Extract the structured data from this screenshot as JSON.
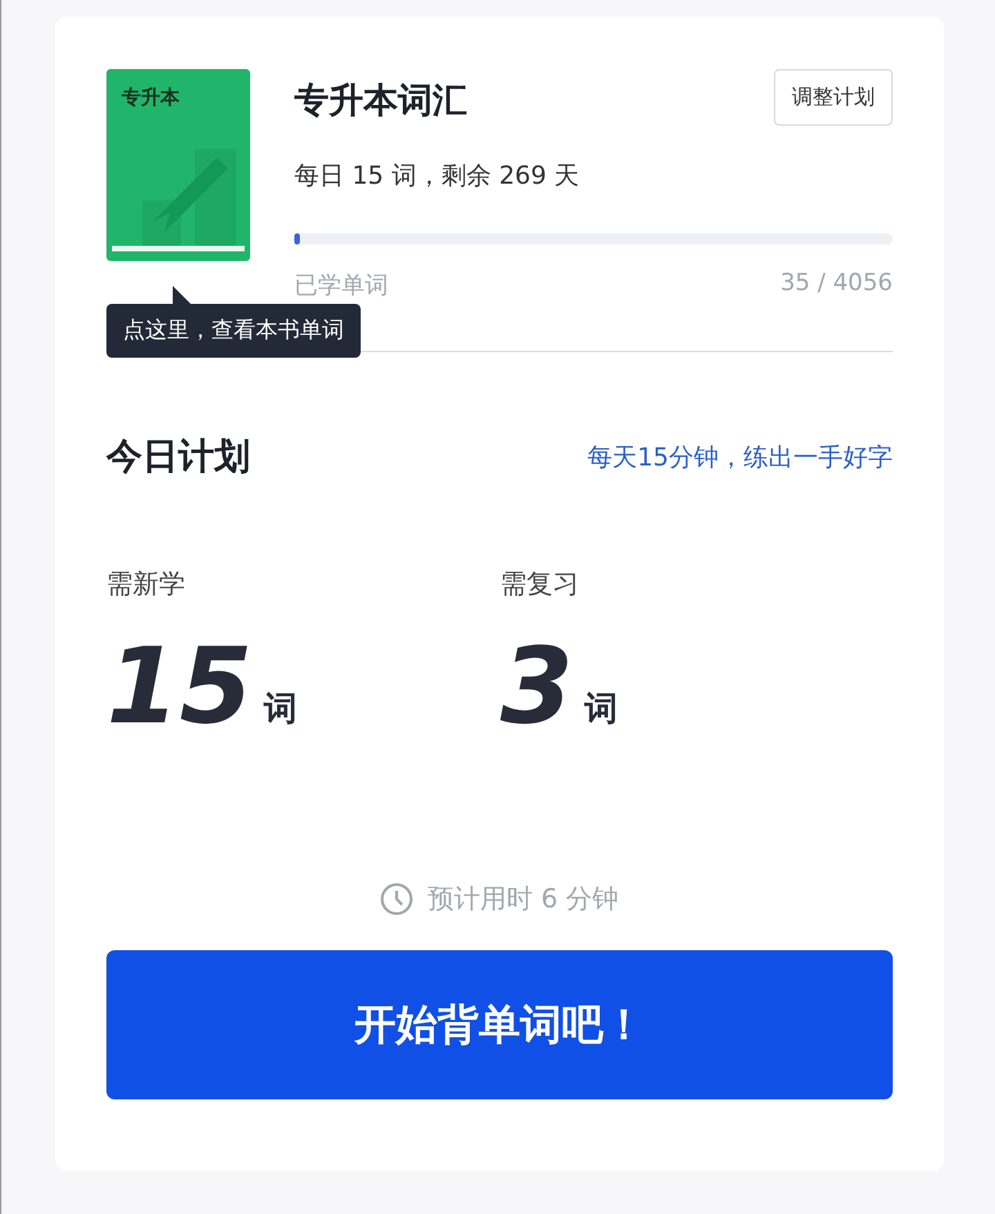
{
  "book": {
    "cover_label": "专升本",
    "title": "专升本词汇",
    "schedule": "每日 15 词，剩余 269 天",
    "adjust_button": "调整计划",
    "progress": {
      "label": "已学单词",
      "level": 0.0086,
      "reading": "35 / 4056"
    },
    "tooltip": "点这里，查看本书单词"
  },
  "plan": {
    "title": "今日计划",
    "promo_link": "每天15分钟，练出一手好字",
    "stats": [
      {
        "label": "需新学",
        "count": "15",
        "unit": "词"
      },
      {
        "label": "需复习",
        "count": "3",
        "unit": "词"
      }
    ],
    "estimate": "预计用时 6 分钟",
    "start_button": "开始背单词吧！"
  }
}
